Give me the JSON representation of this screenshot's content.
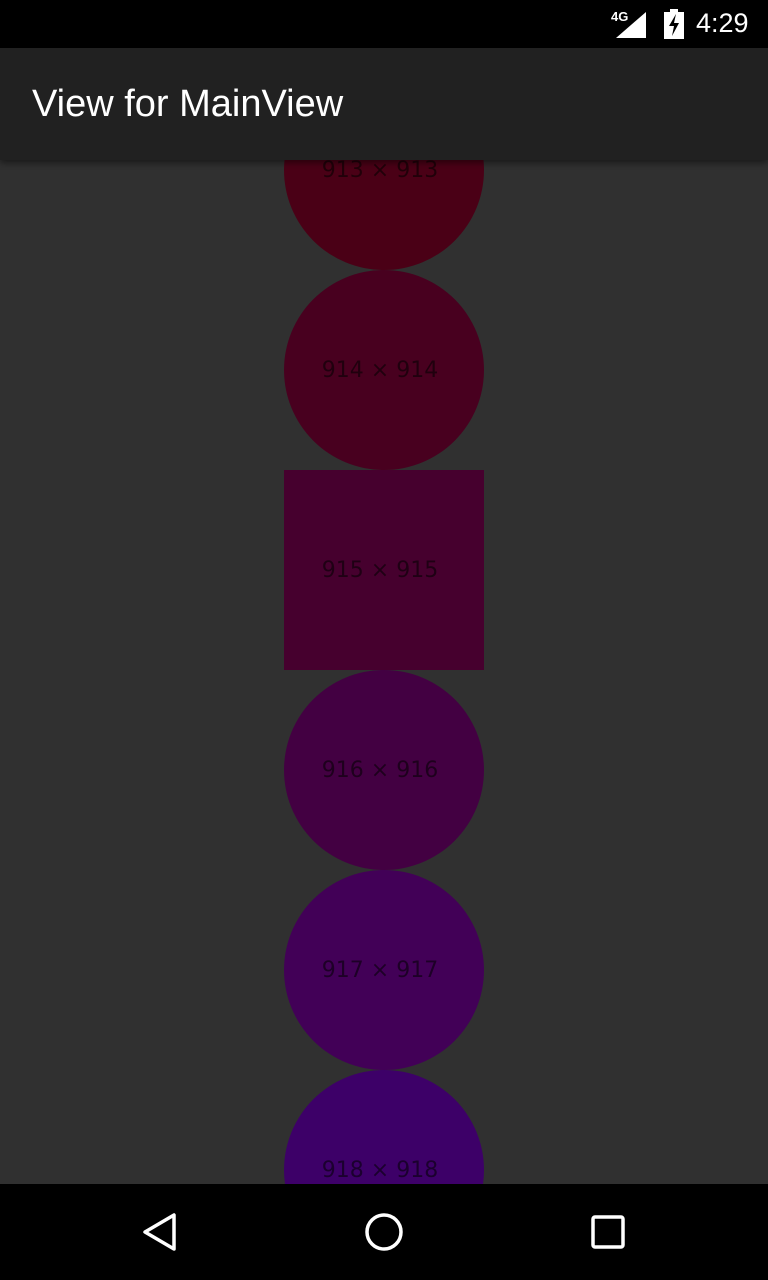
{
  "status_bar": {
    "network": "4G",
    "time": "4:29",
    "icons": [
      "signal-icon",
      "battery-charging-icon"
    ]
  },
  "app_bar": {
    "title": "View for MainView"
  },
  "items": [
    {
      "label": "913 × 913",
      "shape": "circle",
      "color": "#4a0016"
    },
    {
      "label": "914 × 914",
      "shape": "circle",
      "color": "#48001f"
    },
    {
      "label": "915 × 915",
      "shape": "square",
      "color": "#46002e"
    },
    {
      "label": "916 × 916",
      "shape": "circle",
      "color": "#430042"
    },
    {
      "label": "917 × 917",
      "shape": "circle",
      "color": "#420057"
    },
    {
      "label": "918 × 918",
      "shape": "circle",
      "color": "#3d0068"
    }
  ],
  "nav_bar": {
    "icons": [
      "back-icon",
      "home-icon",
      "recents-icon"
    ]
  }
}
